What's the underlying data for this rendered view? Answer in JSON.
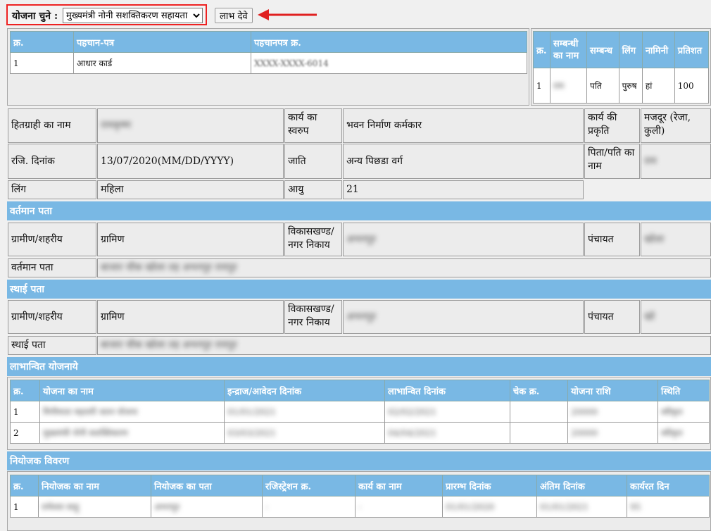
{
  "scheme": {
    "label": "योजना चुने :",
    "selected": "मुख्यमंत्री नोनी सशक्तिकरण सहायता",
    "button": "लाभ देवे"
  },
  "id_table": {
    "headers": [
      "क्र.",
      "पहचान-पत्र",
      "पहचानपत्र क्र."
    ],
    "rows": [
      [
        "1",
        "आधार कार्ड",
        "XXXX-XXXX-6014"
      ]
    ]
  },
  "nominee_table": {
    "headers": [
      "क्र.",
      "सम्बन्धी का नाम",
      "सम्बन्ध",
      "लिंग",
      "नामिनी",
      "प्रतिशत"
    ],
    "rows": [
      [
        "1",
        "राम",
        "पति",
        "पुरुष",
        "हां",
        "100"
      ]
    ]
  },
  "details": {
    "beneficiary_label": "हितग्राही का नाम",
    "beneficiary_value": "रामकृष्ण",
    "work_type_label": "कार्य का स्वरुप",
    "work_type_value": "भवन निर्माण कर्मकार",
    "work_nature_label": "कार्य की प्रकृति",
    "work_nature_value": "मजदूर (रेजा, कुली)",
    "reg_date_label": "रजि. दिनांक",
    "reg_date_value": "13/07/2020(MM/DD/YYYY)",
    "caste_label": "जाति",
    "caste_value": "अन्य पिछडा वर्ग",
    "father_label": "पिता/पति का नाम",
    "father_value": "राम",
    "gender_label": "लिंग",
    "gender_value": "महिला",
    "age_label": "आयु",
    "age_value": "21"
  },
  "current_address": {
    "title": "वर्तमान पता",
    "rural_label": "ग्रामीण/शहरीय",
    "rural_value": "ग्रामिण",
    "block_label": "विकासखण्ड/ नगर निकाय",
    "block_value": "अभनपुर",
    "panchayat_label": "पंचायत",
    "panchayat_value": "खोला",
    "address_label": "वर्तमान पता",
    "address_value": "बाजार चौक खोला तह अभनपुर रायपुर"
  },
  "permanent_address": {
    "title": "स्थाई पता",
    "rural_label": "ग्रामीण/शहरीय",
    "rural_value": "ग्रामिण",
    "block_label": "विकासखण्ड/ नगर निकाय",
    "block_value": "अभनपुर",
    "panchayat_label": "पंचायत",
    "panchayat_value": "खो",
    "address_label": "स्थाई पता",
    "address_value": "बाजार चौक खोला तह अभनपुर रायपुर"
  },
  "benefits": {
    "title": "लाभान्वित योजनाये",
    "headers": [
      "क्र.",
      "योजना का नाम",
      "इन्द्राज/आवेदन दिनांक",
      "लाभान्वित दिनांक",
      "चेक क्र.",
      "योजना राशि",
      "स्थिति"
    ],
    "rows": [
      [
        "1",
        "मिनीमाता महतारी जतन योजना",
        "01/01/2021",
        "02/02/2021",
        "",
        "20000",
        "स्वीकृत"
      ],
      [
        "2",
        "मुख्यमंत्री नोनी सशक्तिकरण",
        "03/03/2021",
        "04/04/2021",
        "",
        "20000",
        "स्वीकृत"
      ]
    ]
  },
  "employer": {
    "title": "नियोजक विवरण",
    "headers": [
      "क्र.",
      "नियोजक का नाम",
      "नियोजक का पता",
      "रजिस्ट्रेशन क्र.",
      "कार्य का नाम",
      "प्रारम्भ दिनांक",
      "अंतिम दिनांक",
      "कार्यरत दिन"
    ],
    "rows": [
      [
        "1",
        "रामेश्वर साहू",
        "अभनपुर",
        "-",
        "-",
        "01/01/2020",
        "01/01/2021",
        "95"
      ]
    ]
  }
}
